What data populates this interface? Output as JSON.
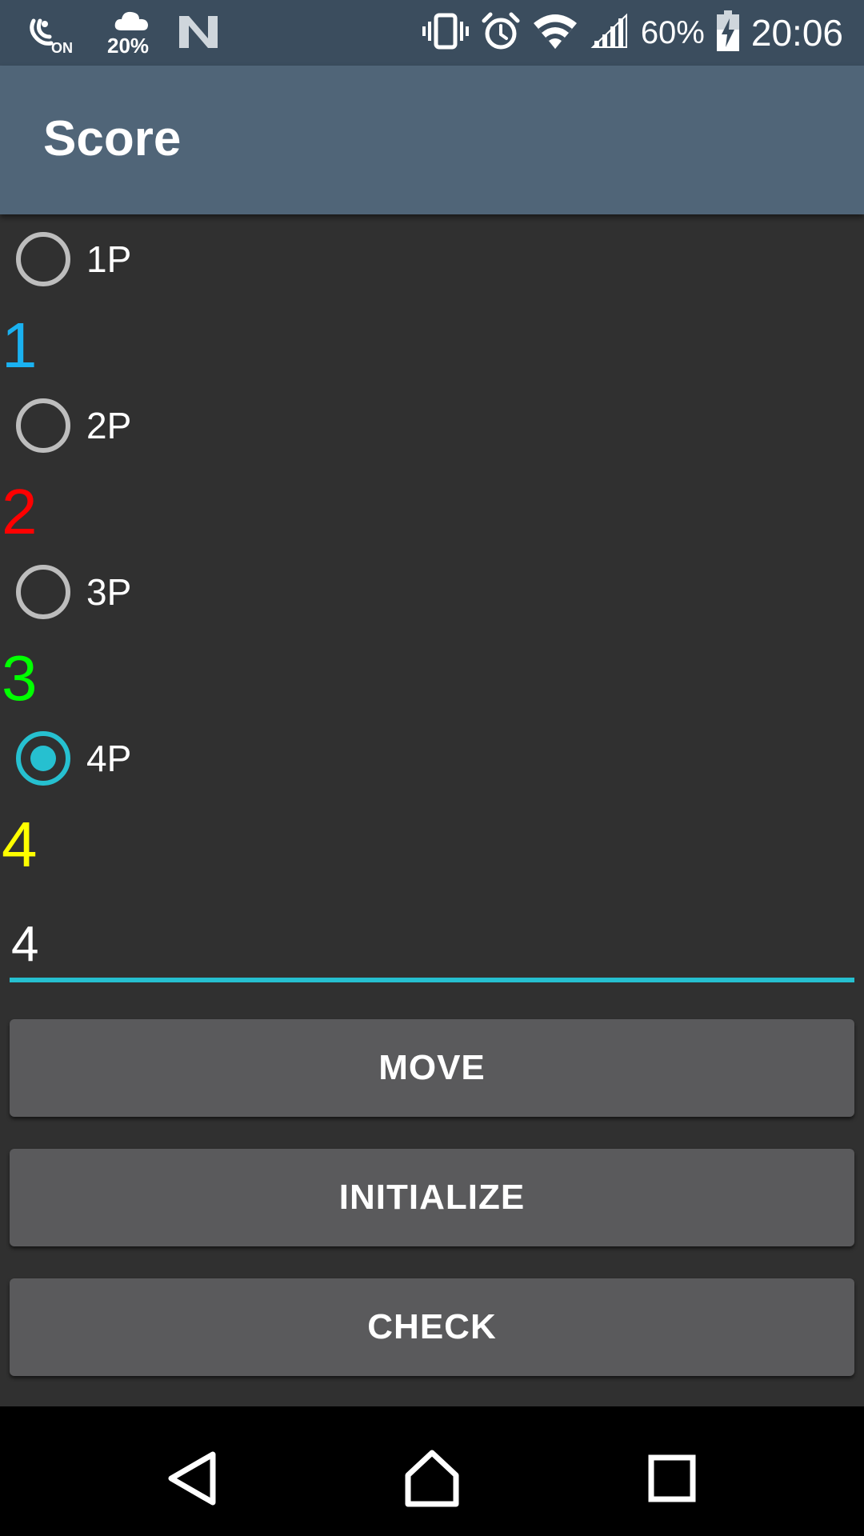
{
  "status_bar": {
    "nfc_label": "ON",
    "weather": "20%",
    "battery_percent": "60%",
    "clock": "20:06",
    "icons": [
      "nfc-icon",
      "cloud-icon",
      "n-notification-icon",
      "vibrate-icon",
      "alarm-icon",
      "wifi-icon",
      "cell-signal-icon",
      "battery-charging-icon"
    ]
  },
  "app_bar": {
    "title": "Score"
  },
  "players": [
    {
      "label": "1P",
      "score": "1",
      "color": "#1ab1f0",
      "checked": false
    },
    {
      "label": "2P",
      "score": "2",
      "color": "#ff0000",
      "checked": false
    },
    {
      "label": "3P",
      "score": "3",
      "color": "#00ff00",
      "checked": false
    },
    {
      "label": "4P",
      "score": "4",
      "color": "#ffff00",
      "checked": true
    }
  ],
  "input": {
    "value": "4"
  },
  "buttons": {
    "move": "MOVE",
    "initialize": "INITIALIZE",
    "check": "CHECK"
  },
  "nav_bar": {
    "icons": [
      "back-icon",
      "home-icon",
      "recents-icon"
    ]
  },
  "colors": {
    "accent": "#26c0d0",
    "app_bar": "#506578",
    "status_bar": "#3b4d5e",
    "background": "#303030",
    "button": "#5a5a5c"
  }
}
